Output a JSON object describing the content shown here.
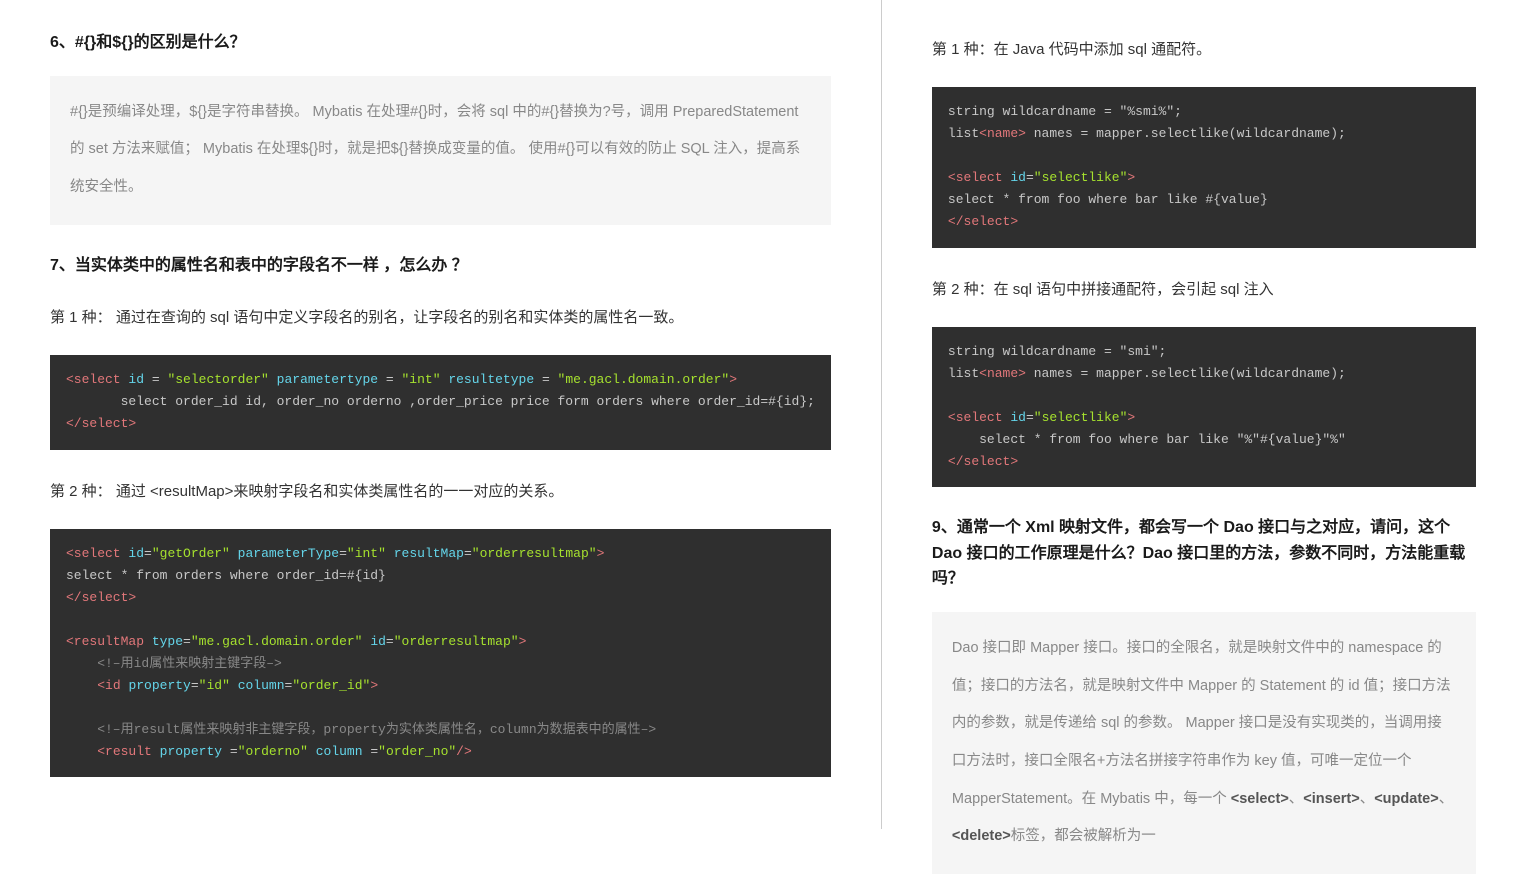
{
  "left": {
    "h6": "6、#{}和${}的区别是什么？",
    "quote6": "#{}是预编译处理，${}是字符串替换。\nMybatis 在处理#{}时，会将 sql 中的#{}替换为?号，调用 PreparedStatement 的 set 方法来赋值；\nMybatis 在处理${}时，就是把${}替换成变量的值。\n使用#{}可以有效的防止 SQL 注入，提高系统安全性。",
    "h7": "7、当实体类中的属性名和表中的字段名不一样 ，怎么办 ？",
    "p7a": "第 1 种： 通过在查询的 sql 语句中定义字段名的别名，让字段名的别名和实体类的属性名一致。",
    "code7a": {
      "l1_open": "<select",
      "l1_attr1": " id ",
      "l1_eq1": "= ",
      "l1_val1": "\"selectorder\"",
      "l1_attr2": " parametertype ",
      "l1_eq2": "= ",
      "l1_val2": "\"int\"",
      "l1_attr3": " resultetype ",
      "l1_eq3": "= ",
      "l1_val3": "\"me.gacl.domain.order\"",
      "l1_close": ">",
      "l2": "       select order_id id, order_no orderno ,order_price price form orders where order_id=#{id};",
      "l3": "</select>"
    },
    "p7b": "第 2 种： 通过 <resultMap>来映射字段名和实体类属性名的一一对应的关系。",
    "code7b": {
      "l1": "<select id=\"getOrder\" parameterType=\"int\" resultMap=\"orderresultmap\">",
      "l2": "select * from orders where order_id=#{id}",
      "l3": "</select>",
      "l4": "",
      "l5": "<resultMap type=\"me.gacl.domain.order\" id=\"orderresultmap\">",
      "l6": "    <!–用id属性来映射主键字段–>",
      "l7": "    <id property=\"id\" column=\"order_id\">",
      "l8": "",
      "l9": "    <!–用result属性来映射非主键字段，property为实体类属性名，column为数据表中的属性–>",
      "l10": "    <result property = \"orderno\" column =\"order_no\"/>"
    }
  },
  "right": {
    "p8a": "第 1 种：在 Java 代码中添加 sql 通配符。",
    "code8a": {
      "l1": "string wildcardname = \"%smi%\";",
      "l2a": "list",
      "l2b": "<name>",
      "l2c": " names = mapper.selectlike(wildcardname);",
      "l3": "",
      "l4": "<select id=\"selectlike\">",
      "l5": "select * from foo where bar like #{value}",
      "l6": "</select>"
    },
    "p8b": "第 2 种：在 sql 语句中拼接通配符，会引起 sql 注入",
    "code8b": {
      "l1": "string wildcardname = \"smi\";",
      "l2a": "list",
      "l2b": "<name>",
      "l2c": " names = mapper.selectlike(wildcardname);",
      "l3": "",
      "l4": "<select id=\"selectlike\">",
      "l5": "    select * from foo where bar like \"%\"#{value}\"%\"",
      "l6": "</select>"
    },
    "h9": "9、通常一个 Xml 映射文件，都会写一个 Dao 接口与之对应，请问，这个 Dao 接口的工作原理是什么？Dao 接口里的方法，参数不同时，方法能重载吗？",
    "quote9_pre": "Dao 接口即 Mapper 接口。接口的全限名，就是映射文件中的 namespace 的值；接口的方法名，就是映射文件中 Mapper 的 Statement 的 id 值；接口方法内的参数，就是传递给 sql 的参数。\nMapper 接口是没有实现类的，当调用接口方法时，接口全限名+方法名拼接字符串作为 key 值，可唯一定位一个 MapperStatement。在 Mybatis 中，每一个 ",
    "quote9_s1": "<select>",
    "quote9_c1": "、",
    "quote9_s2": "<insert>",
    "quote9_c2": "、",
    "quote9_s3": "<update>",
    "quote9_c3": "、",
    "quote9_s4": "<delete>",
    "quote9_post": "标签，都会被解析为一"
  }
}
